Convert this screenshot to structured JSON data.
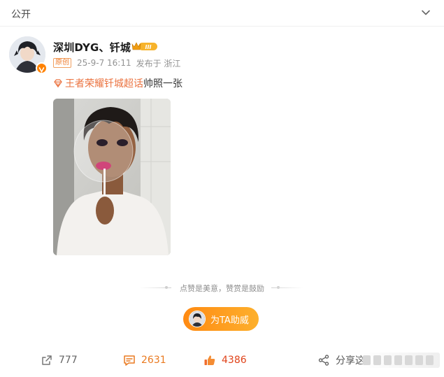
{
  "header": {
    "visibility_label": "公开"
  },
  "post": {
    "author": "深圳DYG、钎城",
    "level_badge_text": "III",
    "original_tag": "原创",
    "date": "25-9-7 16:11",
    "source": "发布于 浙江",
    "topic_link": "王者荣耀钎城超话",
    "body_text": "帅照一张"
  },
  "reward": {
    "slogan": "点赞是美意，赞赏是鼓励",
    "cheer_button_label": "为TA助威"
  },
  "actions": {
    "forward_count": "777",
    "comment_count": "2631",
    "like_count": "4386",
    "share_label": "分享这"
  },
  "colors": {
    "accent_orange": "#ff8200",
    "topic_link": "#eb7340",
    "like_red": "#e0431a",
    "comment_orange": "#ea7a20"
  }
}
